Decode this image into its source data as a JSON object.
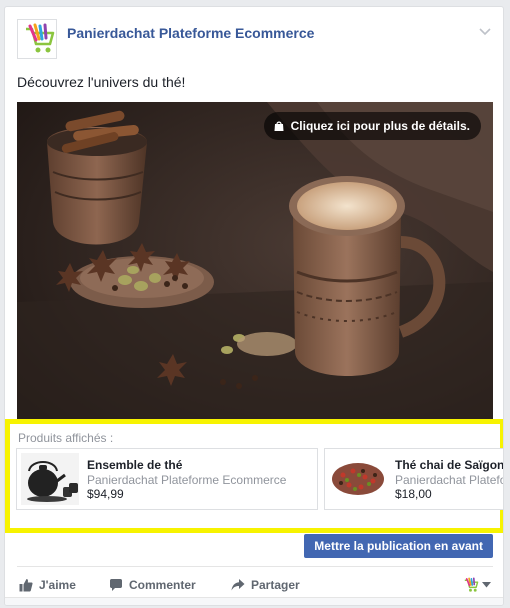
{
  "post": {
    "page_name": "Panierdachat Plateforme Ecommerce",
    "message": "Découvrez l'univers du thé!",
    "photo_cta": "Cliquez ici pour plus de détails."
  },
  "products": {
    "label": "Produits affichés :",
    "items": [
      {
        "name": "Ensemble de thé",
        "seller": "Panierdachat Plateforme Ecommerce",
        "price": "$94,99"
      },
      {
        "name": "Thé chai de Saïgon b",
        "seller": "Panierdachat Platefo",
        "price": "$18,00"
      }
    ]
  },
  "boost": {
    "label": "Mettre la publication en avant"
  },
  "actions": {
    "like": "J'aime",
    "comment": "Commenter",
    "share": "Partager"
  },
  "colors": {
    "link": "#385898",
    "boost": "#4267b2",
    "highlight": "#f7f300"
  }
}
